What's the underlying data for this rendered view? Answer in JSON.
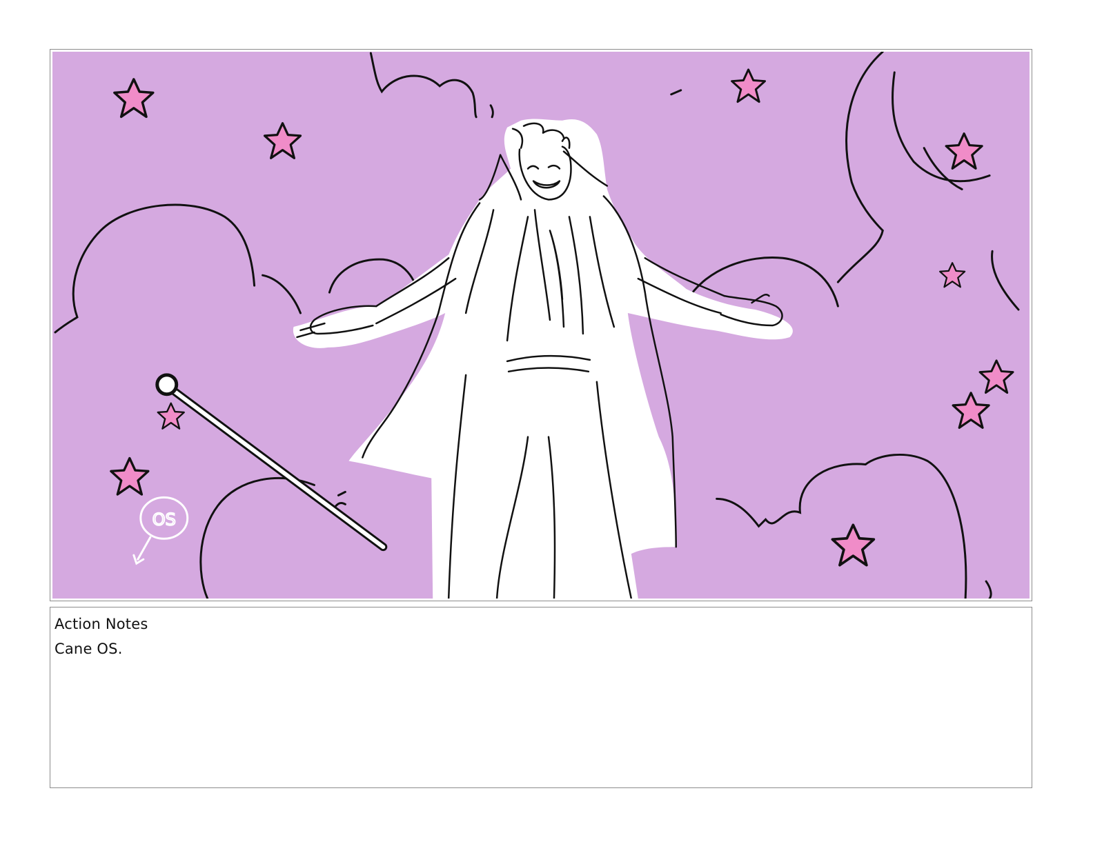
{
  "panel": {
    "background_color": "#d5a9e0",
    "star_fill": "#f08cc8",
    "cloud_line_color": "#111111",
    "figure_fill": "#ffffff",
    "drawing_annotation": "OS"
  },
  "notes": {
    "heading": "Action Notes",
    "text": "Cane OS."
  }
}
